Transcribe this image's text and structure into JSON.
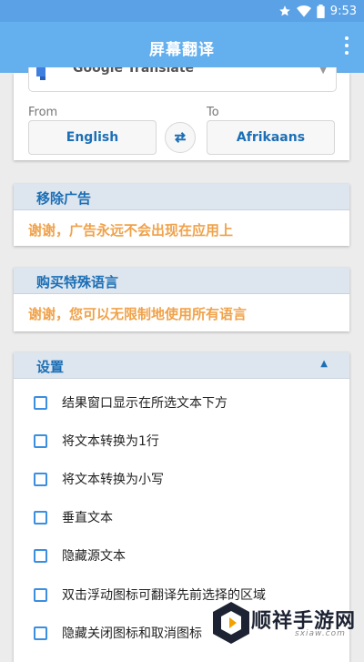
{
  "status_bar": {
    "time": "9:53"
  },
  "app_bar": {
    "title": "屏幕翻译"
  },
  "translate": {
    "service": "Google Translate",
    "from_label": "From",
    "to_label": "To",
    "from_lang": "English",
    "to_lang": "Afrikaans"
  },
  "remove_ads": {
    "title": "移除广告",
    "message": "谢谢，广告永远不会出现在应用上"
  },
  "special_languages": {
    "title": "购买特殊语言",
    "message": "谢谢，您可以无限制地使用所有语言"
  },
  "settings": {
    "title": "设置",
    "options": [
      {
        "label": "结果窗口显示在所选文本下方",
        "checked": false
      },
      {
        "label": "将文本转换为1行",
        "checked": false
      },
      {
        "label": "将文本转换为小写",
        "checked": false
      },
      {
        "label": "垂直文本",
        "checked": false
      },
      {
        "label": "隐藏源文本",
        "checked": false
      },
      {
        "label": "双击浮动图标可翻译先前选择的区域",
        "checked": false
      },
      {
        "label": "隐藏关闭图标和取消图标",
        "checked": false
      }
    ]
  },
  "watermark": {
    "text": "顺祥手游网",
    "sub": "sxiaw.com"
  },
  "colors": {
    "app_bar": "#64b0ef",
    "accent_blue": "#1c6fb6",
    "message_orange": "#f0a24a",
    "section_header": "#dde5ee"
  }
}
